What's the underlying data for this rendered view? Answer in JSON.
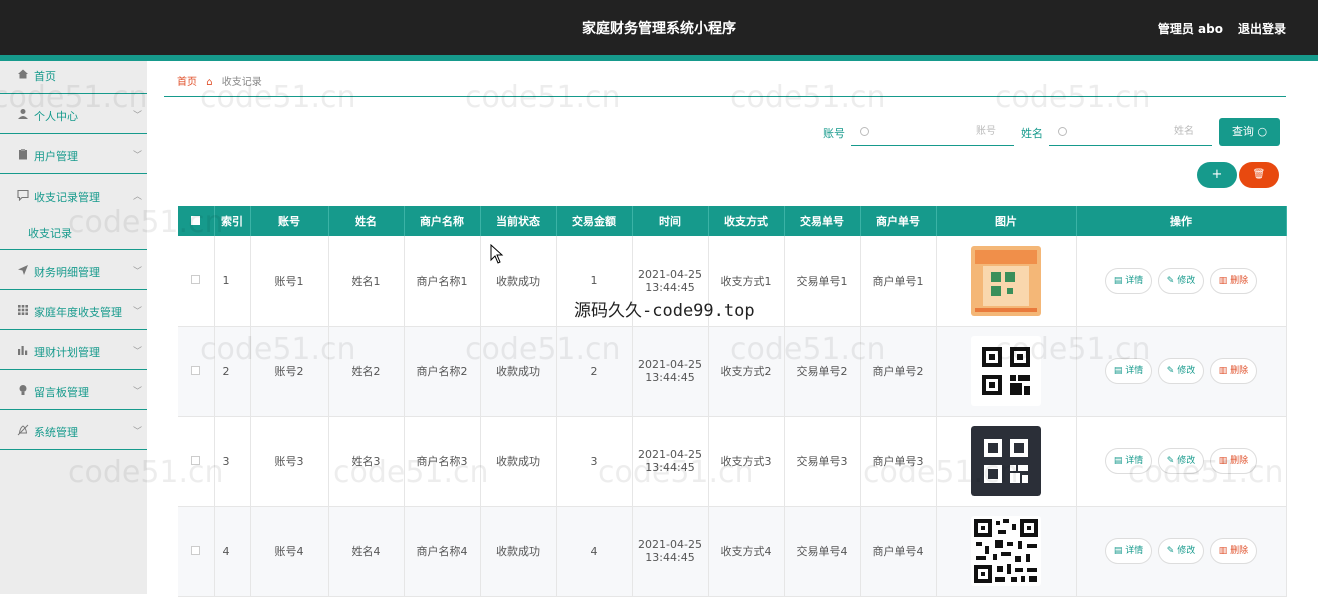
{
  "header": {
    "title": "家庭财务管理系统小程序",
    "admin": "管理员 abo",
    "logout": "退出登录"
  },
  "sidebar": {
    "items": [
      {
        "label": "首页",
        "icon": "home-icon"
      },
      {
        "label": "个人中心",
        "icon": "user-icon"
      },
      {
        "label": "用户管理",
        "icon": "clipboard-icon"
      },
      {
        "label": "收支记录管理",
        "icon": "message-icon"
      },
      {
        "label": "财务明细管理",
        "icon": "send-icon"
      },
      {
        "label": "家庭年度收支管理",
        "icon": "grid-icon"
      },
      {
        "label": "理财计划管理",
        "icon": "bar-chart-icon"
      },
      {
        "label": "留言板管理",
        "icon": "bulb-icon"
      },
      {
        "label": "系统管理",
        "icon": "bell-off-icon"
      }
    ],
    "sub_item": "收支记录"
  },
  "breadcrumb": {
    "home": "首页",
    "current": "收支记录"
  },
  "filters": {
    "account_label": "账号",
    "account_placeholder": "账号",
    "name_label": "姓名",
    "name_placeholder": "姓名",
    "query_button": "查询"
  },
  "actions": {
    "add": "+",
    "delete": "🗑"
  },
  "table": {
    "headers": [
      "索引",
      "账号",
      "姓名",
      "商户名称",
      "当前状态",
      "交易金额",
      "时间",
      "收支方式",
      "交易单号",
      "商户单号",
      "图片",
      "操作"
    ],
    "rows": [
      {
        "index": "1",
        "account": "账号1",
        "name": "姓名1",
        "merchant": "商户名称1",
        "status": "收款成功",
        "amount": "1",
        "date": "2021-04-25",
        "time": "13:44:45",
        "method": "收支方式1",
        "txn_no": "交易单号1",
        "merchant_no": "商户单号1"
      },
      {
        "index": "2",
        "account": "账号2",
        "name": "姓名2",
        "merchant": "商户名称2",
        "status": "收款成功",
        "amount": "2",
        "date": "2021-04-25",
        "time": "13:44:45",
        "method": "收支方式2",
        "txn_no": "交易单号2",
        "merchant_no": "商户单号2"
      },
      {
        "index": "3",
        "account": "账号3",
        "name": "姓名3",
        "merchant": "商户名称3",
        "status": "收款成功",
        "amount": "3",
        "date": "2021-04-25",
        "time": "13:44:45",
        "method": "收支方式3",
        "txn_no": "交易单号3",
        "merchant_no": "商户单号3"
      },
      {
        "index": "4",
        "account": "账号4",
        "name": "姓名4",
        "merchant": "商户名称4",
        "status": "收款成功",
        "amount": "4",
        "date": "2021-04-25",
        "time": "13:44:45",
        "method": "收支方式4",
        "txn_no": "交易单号4",
        "merchant_no": "商户单号4"
      }
    ],
    "ops": {
      "detail": "详情",
      "edit": "修改",
      "remove": "删除"
    }
  },
  "watermarks": {
    "site": "code51.cn",
    "center": "源码久久-code99.top"
  },
  "colors": {
    "accent": "#169a8c",
    "danger": "#e8490f",
    "topbar": "#222222"
  }
}
